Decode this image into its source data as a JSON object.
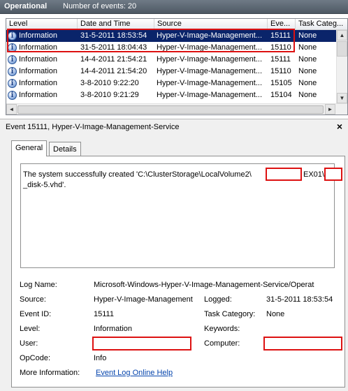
{
  "header": {
    "title": "Operational",
    "event_count": "Number of events: 20"
  },
  "columns": [
    "Level",
    "Date and Time",
    "Source",
    "Eve...",
    "Task Categ..."
  ],
  "events": [
    {
      "level": "Information",
      "datetime": "31-5-2011 18:53:54",
      "source": "Hyper-V-Image-Management...",
      "id": "15111",
      "task": "None",
      "selected": true
    },
    {
      "level": "Information",
      "datetime": "31-5-2011 18:04:43",
      "source": "Hyper-V-Image-Management...",
      "id": "15110",
      "task": "None",
      "selected": false
    },
    {
      "level": "Information",
      "datetime": "14-4-2011 21:54:21",
      "source": "Hyper-V-Image-Management...",
      "id": "15111",
      "task": "None",
      "selected": false
    },
    {
      "level": "Information",
      "datetime": "14-4-2011 21:54:20",
      "source": "Hyper-V-Image-Management...",
      "id": "15110",
      "task": "None",
      "selected": false
    },
    {
      "level": "Information",
      "datetime": "3-8-2010 9:22:20",
      "source": "Hyper-V-Image-Management...",
      "id": "15105",
      "task": "None",
      "selected": false
    },
    {
      "level": "Information",
      "datetime": "3-8-2010 9:21:29",
      "source": "Hyper-V-Image-Management...",
      "id": "15104",
      "task": "None",
      "selected": false
    }
  ],
  "details": {
    "title": "Event 15111, Hyper-V-Image-Management-Service",
    "close": "×",
    "tabs": {
      "general": "General",
      "details": "Details"
    },
    "message": {
      "line1_part1": "The system successfully created 'C:\\ClusterStorage\\LocalVolume2\\",
      "line1_part2": "EX01\\",
      "line2": "_disk-5.vhd'."
    },
    "fields": {
      "log_name_label": "Log Name:",
      "log_name_value": "Microsoft-Windows-Hyper-V-Image-Management-Service/Operat",
      "source_label": "Source:",
      "source_value": "Hyper-V-Image-Management",
      "logged_label": "Logged:",
      "logged_value": "31-5-2011 18:53:54",
      "event_id_label": "Event ID:",
      "event_id_value": "15111",
      "task_category_label": "Task Category:",
      "task_category_value": "None",
      "level_label": "Level:",
      "level_value": "Information",
      "keywords_label": "Keywords:",
      "user_label": "User:",
      "computer_label": "Computer:",
      "opcode_label": "OpCode:",
      "opcode_value": "Info",
      "more_info_label": "More Information:",
      "more_info_link": "Event Log Online Help"
    }
  },
  "icons": {
    "level": "information-icon",
    "close": "close-icon"
  },
  "colors": {
    "selection": "#0a246a",
    "highlight": "#dd1111",
    "link": "#0645ad"
  }
}
